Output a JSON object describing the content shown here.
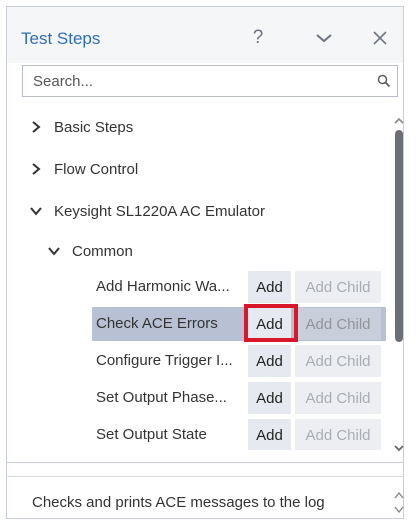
{
  "window": {
    "title": "Test Steps",
    "help_label": "?"
  },
  "search": {
    "placeholder": "Search..."
  },
  "tree": {
    "groups": [
      {
        "label": "Basic Steps",
        "expanded": false
      },
      {
        "label": "Flow Control",
        "expanded": false
      },
      {
        "label": "Keysight SL1220A AC Emulator",
        "expanded": true
      }
    ],
    "subgroup": {
      "label": "Common",
      "expanded": true
    },
    "steps": [
      {
        "label": "Add Harmonic Wa...",
        "add": "Add",
        "add_child": "Add Child",
        "selected": false
      },
      {
        "label": "Check ACE Errors",
        "add": "Add",
        "add_child": "Add Child",
        "selected": true
      },
      {
        "label": "Configure Trigger I...",
        "add": "Add",
        "add_child": "Add Child",
        "selected": false
      },
      {
        "label": "Set Output Phase...",
        "add": "Add",
        "add_child": "Add Child",
        "selected": false
      },
      {
        "label": "Set Output State",
        "add": "Add",
        "add_child": "Add Child",
        "selected": false
      }
    ]
  },
  "description": {
    "text": "Checks and prints ACE messages to the log"
  },
  "colors": {
    "title": "#2f6db5",
    "selected_row": "#b7c1d3",
    "highlight": "#d8182a"
  }
}
